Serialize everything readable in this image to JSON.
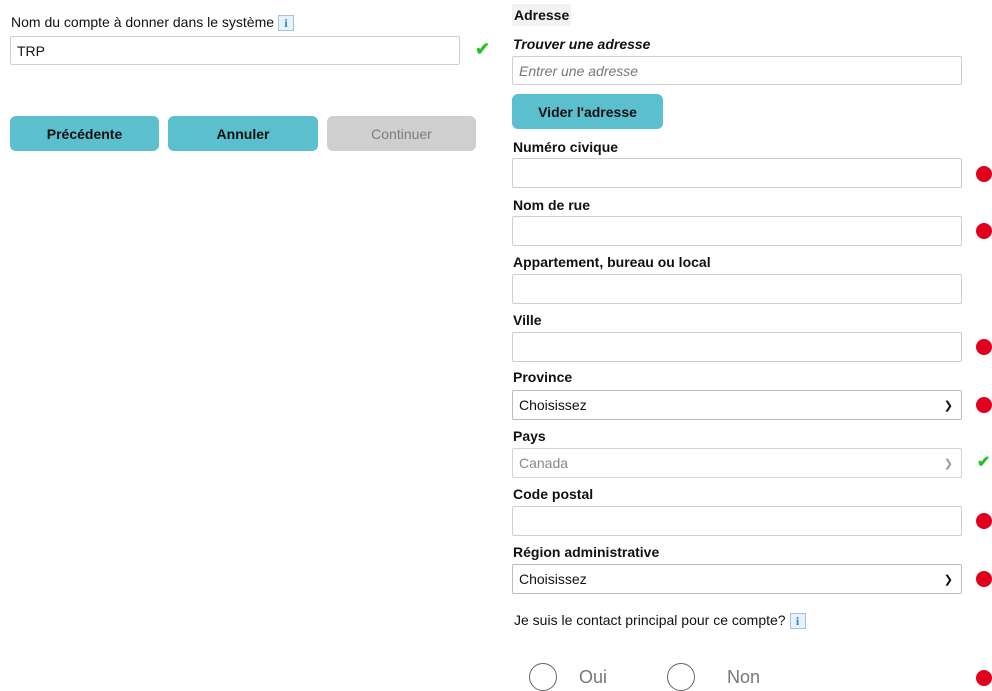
{
  "account": {
    "label": "Nom du compte à donner dans le système",
    "value": "TRP"
  },
  "nav": {
    "previous": "Précédente",
    "cancel": "Annuler",
    "continue": "Continuer"
  },
  "address": {
    "section_title": "Adresse",
    "find_label": "Trouver une adresse",
    "find_placeholder": "Entrer une adresse",
    "clear_button": "Vider l'adresse",
    "civic_number_label": "Numéro civique",
    "street_label": "Nom de rue",
    "unit_label": "Appartement, bureau ou local",
    "city_label": "Ville",
    "province_label": "Province",
    "province_value": "Choisissez",
    "country_label": "Pays",
    "country_value": "Canada",
    "postal_label": "Code postal",
    "region_label": "Région administrative",
    "region_value": "Choisissez"
  },
  "contact": {
    "question": "Je suis le contact principal pour ce compte?",
    "yes": "Oui",
    "no": "Non"
  },
  "colors": {
    "accent": "#5bbfce",
    "error": "#e0001b",
    "valid": "#2bbf2b"
  }
}
